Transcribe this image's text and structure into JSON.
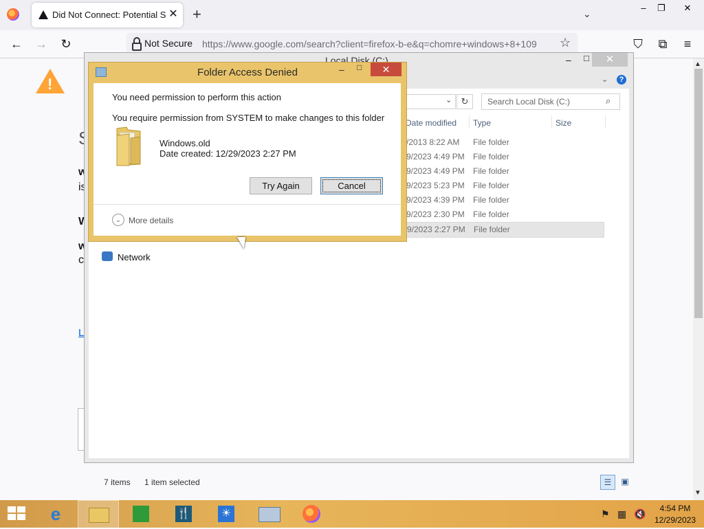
{
  "browser": {
    "tab_title": "Did Not Connect: Potential Security Issue",
    "not_secure_label": "Not Secure",
    "url": "https://www.google.com/search?client=firefox-b-e&q=chomre+windows+8+109",
    "window_min": "–",
    "window_max": "❐",
    "window_close": "✕",
    "new_tab": "+",
    "tab_close": "✕",
    "back": "←",
    "forward": "→",
    "reload": "↻",
    "star": "☆",
    "pocket": "⛉",
    "extensions": "⧉",
    "menu": "≡",
    "tab_list": "⌄"
  },
  "page": {
    "warning_mark": "!",
    "heading_frag": "S",
    "frag_w1": "w",
    "frag_is": "is",
    "frag_w2": "W",
    "frag_w3": "w",
    "frag_c": "c",
    "learn_frag": "L"
  },
  "explorer": {
    "title": "Local Disk (C:)",
    "search_placeholder": "Search Local Disk (C:)",
    "columns": [
      "Date modified",
      "Type",
      "Size"
    ],
    "rows": [
      {
        "date": "/2013 8:22 AM",
        "type": "File folder"
      },
      {
        "date": "9/2023 4:49 PM",
        "type": "File folder"
      },
      {
        "date": "9/2023 4:49 PM",
        "type": "File folder"
      },
      {
        "date": "9/2023 5:23 PM",
        "type": "File folder"
      },
      {
        "date": "9/2023 4:39 PM",
        "type": "File folder"
      },
      {
        "date": "9/2023 2:30 PM",
        "type": "File folder"
      },
      {
        "date": "9/2023 2:27 PM",
        "type": "File folder"
      }
    ],
    "nav_network": "Network",
    "status_count": "7 items",
    "status_selected": "1 item selected",
    "help": "?",
    "minimize": "–",
    "maximize": "□",
    "close": "✕"
  },
  "dialog": {
    "title": "Folder Access Denied",
    "message1": "You need permission to perform this action",
    "message2": "You require permission from SYSTEM to make changes to this folder",
    "folder_name": "Windows.old",
    "date_created": "Date created: 12/29/2023 2:27 PM",
    "try_again": "Try Again",
    "cancel": "Cancel",
    "more_details": "More details",
    "minimize": "–",
    "maximize": "□",
    "close": "✕"
  },
  "taskbar": {
    "time": "4:54 PM",
    "date": "12/29/2023",
    "icons": [
      "internet-explorer-icon",
      "file-explorer-icon",
      "store-icon",
      "restaurant-app-icon",
      "weather-icon",
      "keyboard-icon",
      "firefox-icon"
    ]
  }
}
